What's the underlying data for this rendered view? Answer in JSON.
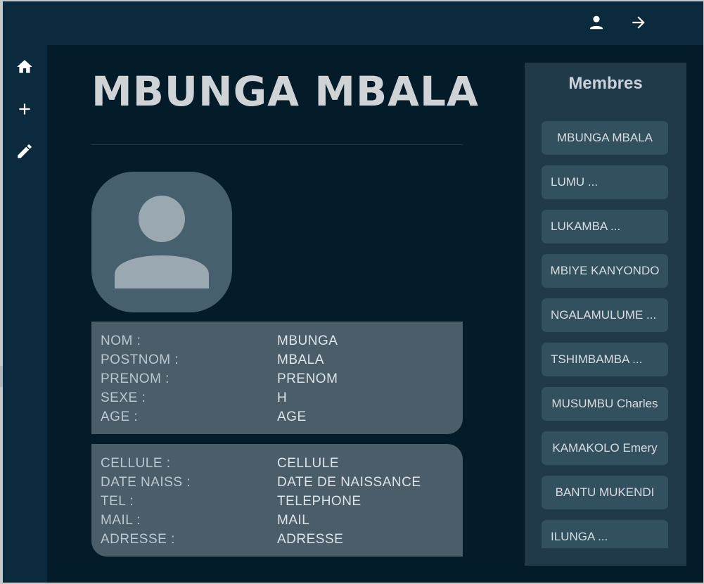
{
  "header": {
    "icons": [
      "account-icon",
      "arrow-right-icon"
    ]
  },
  "sidebar": {
    "items": [
      {
        "icon": "home-icon"
      },
      {
        "icon": "plus-icon"
      },
      {
        "icon": "pencil-icon"
      }
    ]
  },
  "profile": {
    "name": "MBUNGA MBALA",
    "avatar_icon": "user-placeholder-icon",
    "identity": [
      {
        "label": "NOM :",
        "value": "MBUNGA"
      },
      {
        "label": "POSTNOM :",
        "value": "MBALA"
      },
      {
        "label": "PRENOM :",
        "value": "PRENOM"
      },
      {
        "label": "SEXE :",
        "value": "H"
      },
      {
        "label": "AGE :",
        "value": "AGE"
      }
    ],
    "contact": [
      {
        "label": "CELLULE :",
        "value": "CELLULE"
      },
      {
        "label": "DATE NAISS :",
        "value": "DATE DE NAISSANCE"
      },
      {
        "label": "TEL :",
        "value": "TELEPHONE"
      },
      {
        "label": "MAIL :",
        "value": "MAIL"
      },
      {
        "label": "ADRESSE :",
        "value": "ADRESSE"
      }
    ]
  },
  "members": {
    "title": "Membres",
    "items": [
      "MBUNGA MBALA",
      "LUMU ...",
      "LUKAMBA ...",
      "MBIYE KANYONDO",
      "NGALAMULUME ...",
      "TSHIMBAMBA ...",
      "MUSUMBU Charles",
      "KAMAKOLO Emery",
      "BANTU MUKENDI",
      "ILUNGA ..."
    ]
  },
  "colors": {
    "background": "#041b29",
    "bars": "#0b2a3d",
    "card": "#4a5d69",
    "panel": "#213a49",
    "member_item": "#33505f"
  }
}
